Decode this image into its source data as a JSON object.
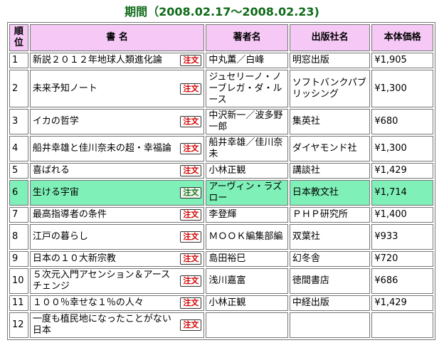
{
  "period": "期間（2008.02.17〜2008.02.23)",
  "headers": [
    "順位",
    "書 名",
    "著者名",
    "出版社名",
    "本体価格"
  ],
  "order_label": "注文",
  "rows": [
    {
      "rank": "1",
      "title": "新説２０１２年地球人類進化論",
      "author": "中丸薫／白峰",
      "publisher": "明窓出版",
      "price": "¥1,905"
    },
    {
      "rank": "2",
      "title": "未来予知ノート",
      "author": "ジュセリーノ・ノーブレガ・ダ・ルース",
      "publisher": "ソフトバンクパブリッシング",
      "price": "¥1,300"
    },
    {
      "rank": "3",
      "title": "イカの哲学",
      "author": "中沢新一／波多野一郎",
      "publisher": "集英社",
      "price": "¥680"
    },
    {
      "rank": "4",
      "title": "船井幸雄と佳川奈未の超・幸福論",
      "author": "船井幸雄／佳川奈未",
      "publisher": "ダイヤモンド社",
      "price": "¥1,300"
    },
    {
      "rank": "5",
      "title": "喜ばれる",
      "author": "小林正観",
      "publisher": "講談社",
      "price": "¥1,429"
    },
    {
      "rank": "6",
      "title": "生ける宇宙",
      "author": "アーヴィン・ラズロー",
      "publisher": "日本教文社",
      "price": "¥1,714",
      "highlight": true
    },
    {
      "rank": "7",
      "title": "最高指導者の条件",
      "author": "李登輝",
      "publisher": "ＰＨＰ研究所",
      "price": "¥1,400"
    },
    {
      "rank": "8",
      "title": "江戸の暮らし",
      "author": "ＭＯＯＫ編集部編",
      "publisher": "双葉社",
      "price": "¥933"
    },
    {
      "rank": "9",
      "title": "日本の１０大新宗教",
      "author": "島田裕巳",
      "publisher": "幻冬舎",
      "price": "¥720"
    },
    {
      "rank": "10",
      "title": "５次元入門アセンション＆アースチェンジ",
      "author": "浅川嘉富",
      "publisher": "徳間書店",
      "price": "¥686"
    },
    {
      "rank": "11",
      "title": "１００％幸せな１％の人々",
      "author": "小林正観",
      "publisher": "中経出版",
      "price": "¥1,429"
    },
    {
      "rank": "12",
      "title": "一度も植民地になったことがない日本",
      "author": "",
      "publisher": "",
      "price": ""
    }
  ]
}
